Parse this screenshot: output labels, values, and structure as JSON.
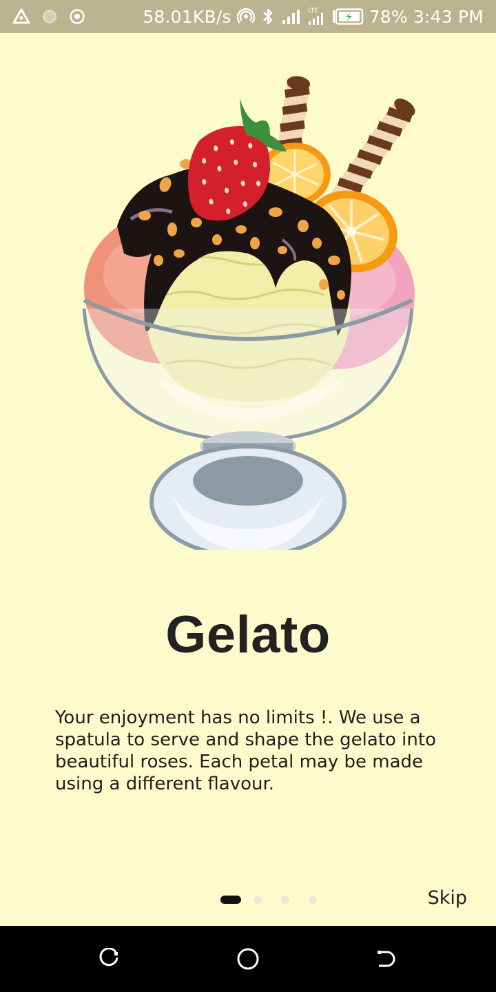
{
  "status_bar": {
    "left_icons": [
      "delta-icon",
      "circle-dot-icon",
      "target-icon"
    ],
    "net_speed": "58.01KB/s",
    "network_type": "LTE",
    "battery_percent": "78%",
    "time": "3:43 PM"
  },
  "onboarding": {
    "title": "Gelato",
    "description": "Your enjoyment has no limits !. We use a spatula to serve and shape the gelato into beautiful roses. Each petal may be made using a different flavour.",
    "page_count": 4,
    "active_page": 1,
    "skip_label": "Skip"
  },
  "colors": {
    "background": "#fdfbcc",
    "status_bar": "#b9b48f",
    "active_dot": "#111111",
    "inactive_dot": "#e9e8de"
  },
  "nav_bar": {
    "buttons": [
      "recent-apps-icon",
      "home-icon",
      "back-icon"
    ]
  }
}
